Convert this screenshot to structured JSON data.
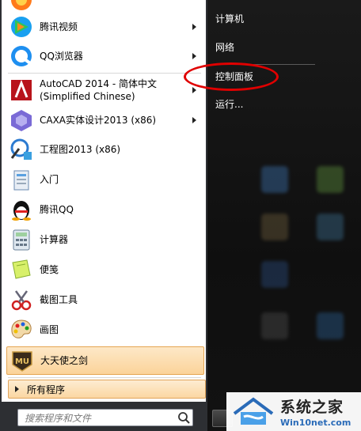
{
  "left_items": [
    {
      "label": "腾讯视频",
      "has_arrow": true
    },
    {
      "label": "QQ浏览器",
      "has_arrow": true
    },
    {
      "label": "AutoCAD 2014 - 简体中文",
      "label2": "(Simplified Chinese)",
      "has_arrow": true
    },
    {
      "label": "CAXA实体设计2013 (x86)",
      "has_arrow": true
    },
    {
      "label": "工程图2013 (x86)"
    },
    {
      "label": "入门"
    },
    {
      "label": "腾讯QQ"
    },
    {
      "label": "计算器"
    },
    {
      "label": "便笺"
    },
    {
      "label": "截图工具"
    },
    {
      "label": "画图"
    },
    {
      "label": "大天使之剑",
      "highlighted": true
    }
  ],
  "all_programs": "所有程序",
  "search_placeholder": "搜索程序和文件",
  "right_items": [
    {
      "label": "计算机"
    },
    {
      "label": "网络"
    },
    {
      "label": "控制面板",
      "annotated": true
    },
    {
      "label": "运行..."
    }
  ],
  "watermark": {
    "title": "系统之家",
    "url": "Win10net.com"
  },
  "colors": {
    "annotation": "#e00000",
    "highlight": "#fbd39a",
    "menu_dark": "#2d2f33"
  }
}
